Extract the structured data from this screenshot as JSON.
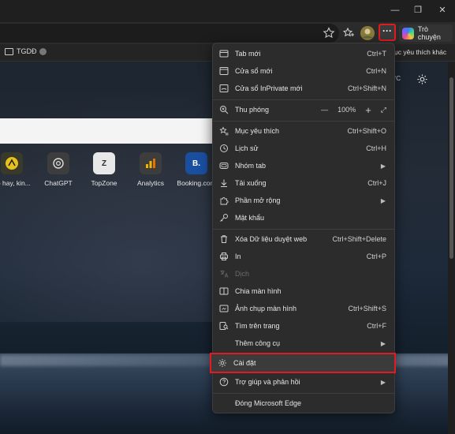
{
  "favorites": {
    "folder": "TGDĐ",
    "folder_badge": "",
    "more": "ục yêu thích khác"
  },
  "toolbar": {
    "chat_label": "Trò chuyện",
    "more_label": "···"
  },
  "window": {
    "minimize": "—",
    "maximize": "❐",
    "close": "✕"
  },
  "page": {
    "weather": "°C",
    "tiles": [
      {
        "label": "ao hay, kin...",
        "glyph": ""
      },
      {
        "label": "ChatGPT",
        "glyph": ""
      },
      {
        "label": "TopZone",
        "glyph": "Z"
      },
      {
        "label": "Analytics",
        "glyph": ""
      },
      {
        "label": "Booking.com",
        "glyph": "B."
      }
    ]
  },
  "menu": {
    "new_tab": {
      "label": "Tab mới",
      "shortcut": "Ctrl+T"
    },
    "new_window": {
      "label": "Cửa sổ mới",
      "shortcut": "Ctrl+N"
    },
    "new_inprivate": {
      "label": "Cửa sổ InPrivate mới",
      "shortcut": "Ctrl+Shift+N"
    },
    "zoom": {
      "label": "Thu phóng",
      "minus": "—",
      "value": "100%",
      "plus": "+",
      "full": "⤢"
    },
    "favorites": {
      "label": "Mục yêu thích",
      "shortcut": "Ctrl+Shift+O"
    },
    "history": {
      "label": "Lịch sử",
      "shortcut": "Ctrl+H"
    },
    "tab_groups": {
      "label": "Nhóm tab"
    },
    "downloads": {
      "label": "Tải xuống",
      "shortcut": "Ctrl+J"
    },
    "extensions": {
      "label": "Phần mở rộng"
    },
    "passwords": {
      "label": "Mật khẩu"
    },
    "clear_data": {
      "label": "Xóa Dữ liệu duyệt web",
      "shortcut": "Ctrl+Shift+Delete"
    },
    "print": {
      "label": "In",
      "shortcut": "Ctrl+P"
    },
    "translate": {
      "label": "Dịch"
    },
    "split_screen": {
      "label": "Chia màn hình"
    },
    "screenshot": {
      "label": "Ảnh chụp màn hình",
      "shortcut": "Ctrl+Shift+S"
    },
    "find": {
      "label": "Tìm trên trang",
      "shortcut": "Ctrl+F"
    },
    "more_tools": {
      "label": "Thêm công cụ"
    },
    "settings": {
      "label": "Cài đặt"
    },
    "help": {
      "label": "Trợ giúp và phản hồi"
    },
    "close_edge": {
      "label": "Đóng Microsoft Edge"
    },
    "arrow": "▶"
  },
  "colors": {
    "highlight_border": "#e21b23",
    "menu_bg": "#2c2c2c"
  }
}
